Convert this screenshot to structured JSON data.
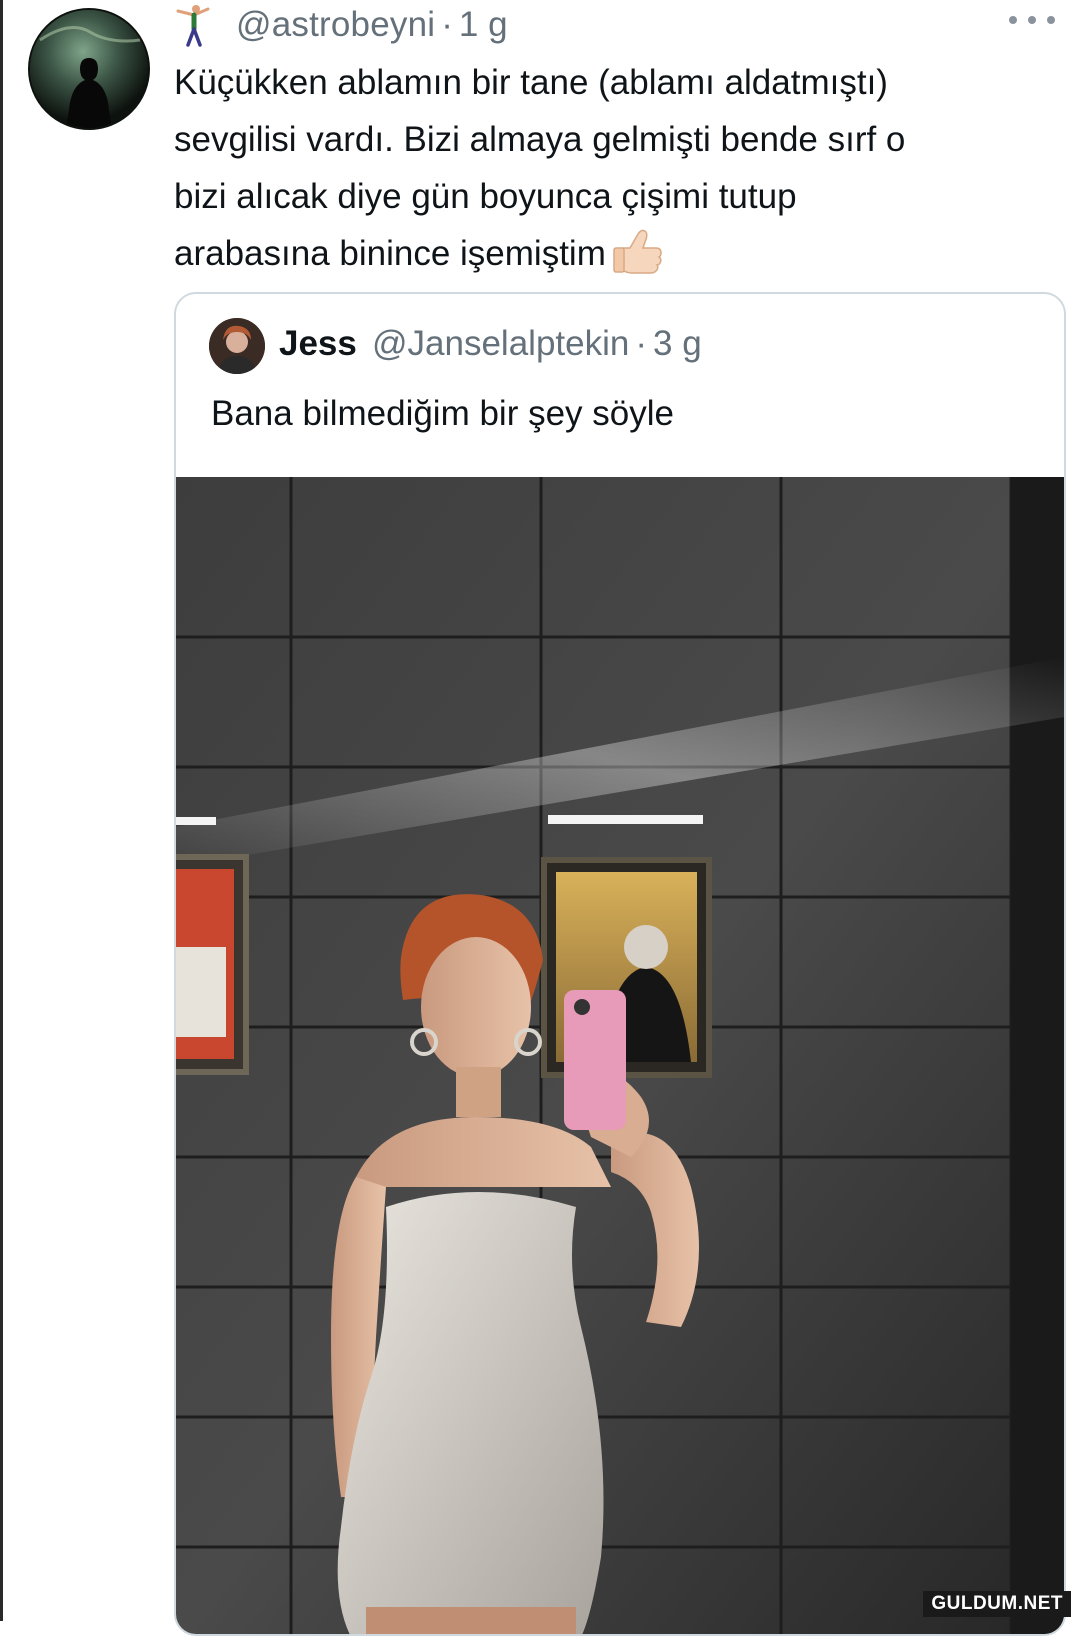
{
  "tweet": {
    "handle": "@astrobeyni",
    "separator": "·",
    "time": "1 g",
    "lines": [
      "Küçükken ablamın bir tane (ablamı aldatmıştı)",
      "sevgilisi vardı. Bizi almaya gelmişti bende sırf o",
      "bizi alıcak diye gün boyunca çişimi tutup",
      "arabasına binince işemiştim"
    ],
    "emoji_icon": "thumbs-up-icon",
    "figure_icon": "person-stretching-icon"
  },
  "quote": {
    "name": "Jess",
    "handle": "@Janselalptekin",
    "separator": "·",
    "time": "3 g",
    "text": "Bana bilmediğim bir şey söyle"
  },
  "watermark": "GULDUM.NET",
  "colors": {
    "text": "#0f1419",
    "secondary": "#64707a",
    "border": "#cfd9de"
  }
}
